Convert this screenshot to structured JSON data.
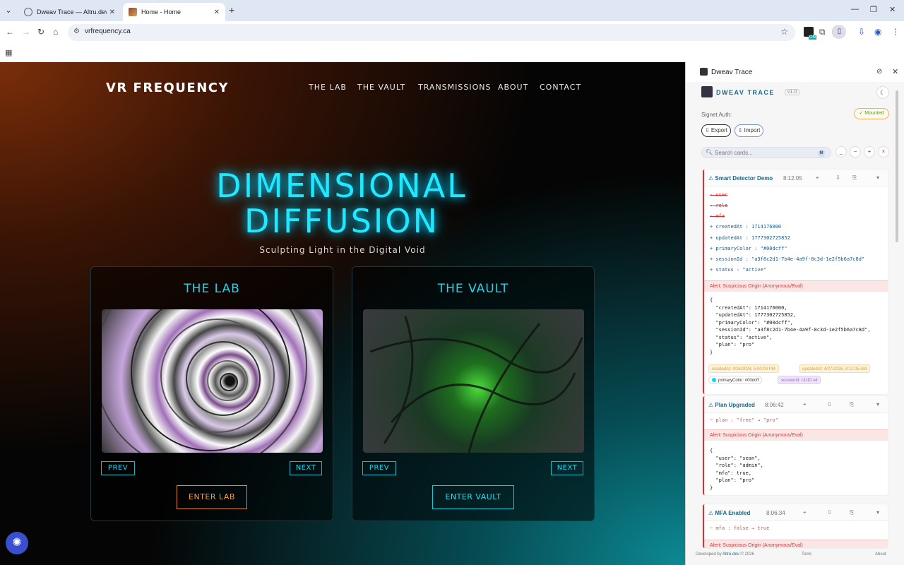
{
  "browser": {
    "tabs": [
      {
        "title": "Dweav Trace — Altru.dev | Stat",
        "active": false
      },
      {
        "title": "Home - Home",
        "active": true
      }
    ],
    "url": "vrfrequency.ca"
  },
  "site": {
    "logo": "VR FREQUENCY",
    "nav": [
      "THE LAB",
      "THE VAULT",
      "TRANSMISSIONS",
      "ABOUT",
      "CONTACT"
    ],
    "hero_line1": "DIMENSIONAL",
    "hero_line2": "DIFFUSION",
    "tagline": "Sculpting Light in the Digital Void",
    "cards": [
      {
        "title": "THE LAB",
        "prev": "PREV",
        "next": "NEXT",
        "enter": "ENTER LAB"
      },
      {
        "title": "THE VAULT",
        "prev": "PREV",
        "next": "NEXT",
        "enter": "ENTER VAULT"
      }
    ]
  },
  "panel": {
    "window_title": "Dweav Trace",
    "ext_name": "DWEAV TRACE",
    "version": "v1.0",
    "signet_label": "Signet Auth:",
    "mounted": "✓ Mounted",
    "export_label": "⇩ Export",
    "import_label": "⇩ Import",
    "search_placeholder": "Search cards...",
    "search_kbd": "M",
    "controls": [
      "_",
      "−",
      "+",
      "×"
    ],
    "cards": [
      {
        "title": "⚠ Smart Detector Demo",
        "time": "8:12:05",
        "removed": [
          "- user",
          "- role",
          "- mfa"
        ],
        "added": [
          "+ createdAt : 1714176000",
          "+ updatedAt : 1777302725852",
          "+ primaryColor : \"#00dcff\"",
          "+ sessionId : \"a3f8c2d1-7b4e-4a9f-8c3d-1e2f5b6a7c8d\"",
          "+ status : \"active\""
        ],
        "alert": "Alert: Suspicious Origin (Anonymous/Eval)",
        "json": "{\n  \"createdAt\": 1714176000,\n  \"updatedAt\": 1777302725852,\n  \"primaryColor\": \"#00dcff\",\n  \"sessionId\": \"a3f8c2d1-7b4e-4a9f-8c3d-1e2f5b6a7c8d\",\n  \"status\": \"active\",\n  \"plan\": \"pro\"\n}",
        "chips": {
          "created": "createdAt: 4/26/2024, 5:00:00 PM",
          "updated": "updatedAt: 4/27/2026, 8:12:05 AM",
          "color": "primaryColor: #00dcff",
          "session": "sessionId: UUID v4"
        }
      },
      {
        "title": "⚠ Plan Upgraded",
        "time": "8:06:42",
        "changed": "~ plan : \"free\" → \"pro\"",
        "alert": "Alert: Suspicious Origin (Anonymous/Eval)",
        "json": "{\n  \"user\": \"sean\",\n  \"role\": \"admin\",\n  \"mfa\": true,\n  \"plan\": \"pro\"\n}"
      },
      {
        "title": "⚠ MFA Enabled",
        "time": "8:06:34",
        "changed": "~ mfa : false → true",
        "alert": "Alert: Suspicious Origin (Anonymous/Eval)"
      }
    ],
    "footer": {
      "developed_prefix": "Developed by ",
      "developed_link": "Altru.dev",
      "developed_suffix": " © 2026",
      "tools": "Tools",
      "about": "About"
    }
  }
}
